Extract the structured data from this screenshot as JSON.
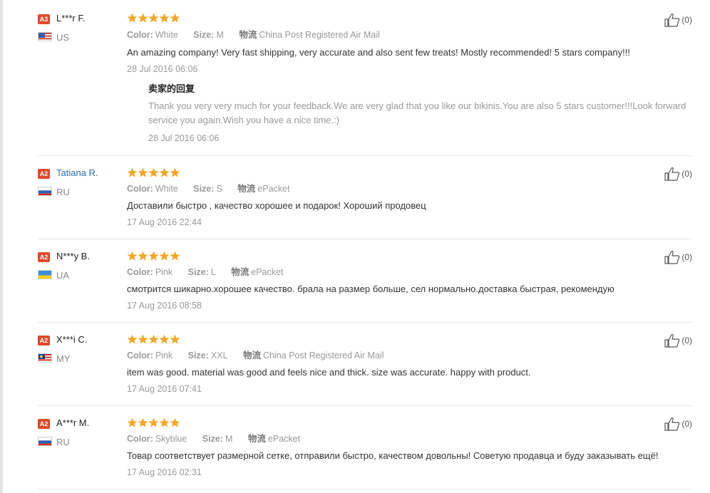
{
  "reviews": [
    {
      "level": "A3",
      "name": "L***r F.",
      "country": "US",
      "rating": "5 of 5",
      "color_label": "Color:",
      "color": "White",
      "size_label": "Size:",
      "size": "M",
      "shipping_label": "物流",
      "shipping": "China Post Registered Air Mail",
      "text": "An amazing company! Very fast shipping, very accurate and also sent few treats! Mostly recommended! 5 stars company!!!",
      "date": "28 Jul 2016 06:06",
      "helpful": "(0)",
      "reply": {
        "title": "卖家的回复",
        "text": "Thank you very very much for your feedback.We are very glad that you like our bikinis.You are also 5 stars customer!!!Look forward service you again.Wish you have a nice time.:)",
        "date": "28 Jul 2016 06:06"
      }
    },
    {
      "level": "A2",
      "name": "Tatiana R.",
      "country": "RU",
      "rating": "5 of 5",
      "color_label": "Color:",
      "color": "White",
      "size_label": "Size:",
      "size": "S",
      "shipping_label": "物流",
      "shipping": "ePacket",
      "text": "Доставили быстро , качество хорошее и подарок! Хороший продовец",
      "date": "17 Aug 2016 22:44",
      "helpful": "(0)"
    },
    {
      "level": "A2",
      "name": "N***y B.",
      "country": "UA",
      "rating": "5 of 5",
      "color_label": "Color:",
      "color": "Pink",
      "size_label": "Size:",
      "size": "L",
      "shipping_label": "物流",
      "shipping": "ePacket",
      "text": "смотрится шикарно.хорошее качество. брала на размер больше, сел нормально.доставка быстрая, рекомендую",
      "date": "17 Aug 2016 08:58",
      "helpful": "(0)"
    },
    {
      "level": "A2",
      "name": "X***i C.",
      "country": "MY",
      "rating": "5 of 5",
      "color_label": "Color:",
      "color": "Pink",
      "size_label": "Size:",
      "size": "XXL",
      "shipping_label": "物流",
      "shipping": "China Post Registered Air Mail",
      "text": "item was good. material was good and feels nice and thick. size was accurate. happy with product.",
      "date": "17 Aug 2016 07:41",
      "helpful": "(0)"
    },
    {
      "level": "A2",
      "name": "A***r M.",
      "country": "RU",
      "rating": "5 of 5",
      "color_label": "Color:",
      "color": "Skyblue",
      "size_label": "Size:",
      "size": "M",
      "shipping_label": "物流",
      "shipping": "ePacket",
      "text": "Товар соответствует размерной сетке, отправили быстро, качеством довольны! Советую продавца и буду заказывать ещё!",
      "date": "17 Aug 2016 02:31",
      "helpful": "(0)"
    }
  ],
  "colors": {
    "badge": "#e0492a",
    "star": "#f5a623",
    "name_link": "#2a6fb0"
  }
}
